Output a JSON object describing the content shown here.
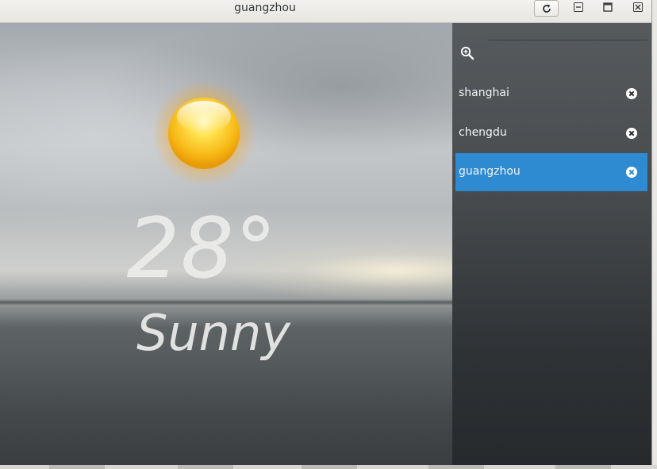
{
  "window": {
    "title": "guangzhou"
  },
  "titlebar": {
    "refresh_icon": "refresh-icon",
    "minimize_icon": "minimize-icon",
    "maximize_icon": "maximize-icon",
    "close_icon": "close-icon"
  },
  "weather": {
    "temperature": "28°",
    "condition": "Sunny",
    "icon": "sun-icon"
  },
  "sidebar": {
    "search_icon": "zoom-search-icon",
    "cities": [
      {
        "name": "shanghai",
        "selected": false
      },
      {
        "name": "chengdu",
        "selected": false
      },
      {
        "name": "guangzhou",
        "selected": true
      }
    ]
  },
  "colors": {
    "selection": "#2e8ad1",
    "titlebar": "#eeedeb",
    "text_light": "#f4f4f4"
  }
}
